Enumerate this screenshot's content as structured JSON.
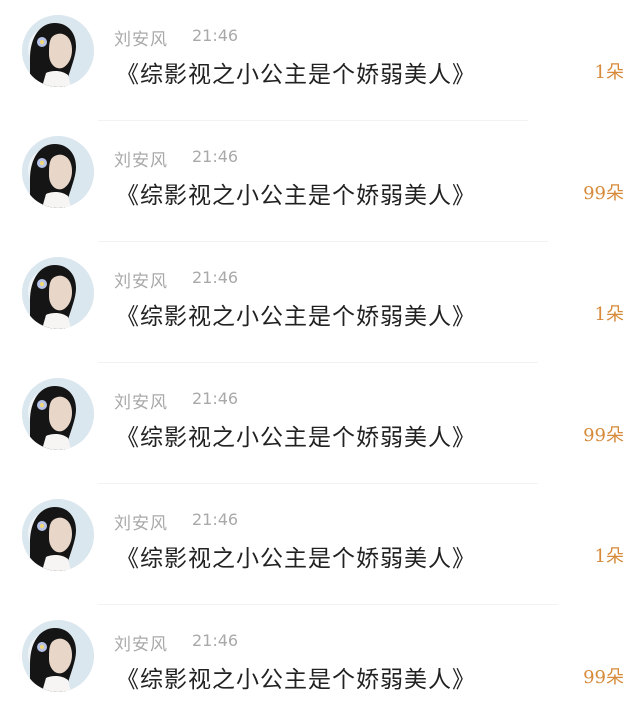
{
  "comments": [
    {
      "name": "刘安风",
      "time": "21:46",
      "message": "《综影视之小公主是个娇弱美人》",
      "gift": "1朵"
    },
    {
      "name": "刘安风",
      "time": "21:46",
      "message": "《综影视之小公主是个娇弱美人》",
      "gift": "99朵"
    },
    {
      "name": "刘安风",
      "time": "21:46",
      "message": "《综影视之小公主是个娇弱美人》",
      "gift": "1朵"
    },
    {
      "name": "刘安风",
      "time": "21:46",
      "message": "《综影视之小公主是个娇弱美人》",
      "gift": "99朵"
    },
    {
      "name": "刘安风",
      "time": "21:46",
      "message": "《综影视之小公主是个娇弱美人》",
      "gift": "1朵"
    },
    {
      "name": "刘安风",
      "time": "21:46",
      "message": "《综影视之小公主是个娇弱美人》",
      "gift": "99朵"
    }
  ],
  "colors": {
    "meta": "#a9a9a9",
    "message": "#222222",
    "gift": "#d68a3a",
    "divider": "#f2f2f2"
  },
  "icons": {
    "avatar": "woman-portrait-with-flower-avatar"
  }
}
